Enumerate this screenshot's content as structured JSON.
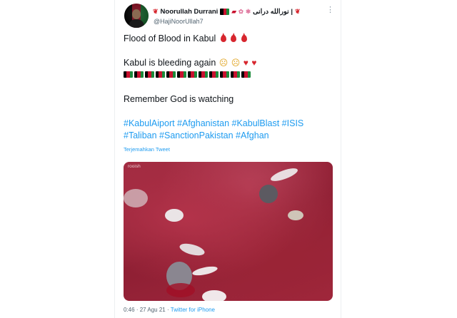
{
  "tweet": {
    "author_name": "Noorullah Durrani",
    "author_suffix": "نورالله درانی |",
    "handle": "@HajiNoorUllah7",
    "more_icon": "⋮",
    "line1": "Flood of Blood in Kabul",
    "line2": "Kabul is bleeding again",
    "line3": "Remember God is watching",
    "hashtags_line1": "#KabulAiport #Afghanistan #KabulBlast #ISIS",
    "hashtags_line2": "#Taliban #SanctionPakistan #Afghan",
    "translate_label": "Terjemahkan Tweet",
    "media_watermark": "rooish",
    "time": "0:46",
    "date": "27 Agu 21",
    "separator": "·",
    "source": "Twitter for iPhone",
    "flag_count": 12
  },
  "colors": {
    "link": "#1d9bf0",
    "blood_red": "#d7262e",
    "muted": "#536471"
  }
}
